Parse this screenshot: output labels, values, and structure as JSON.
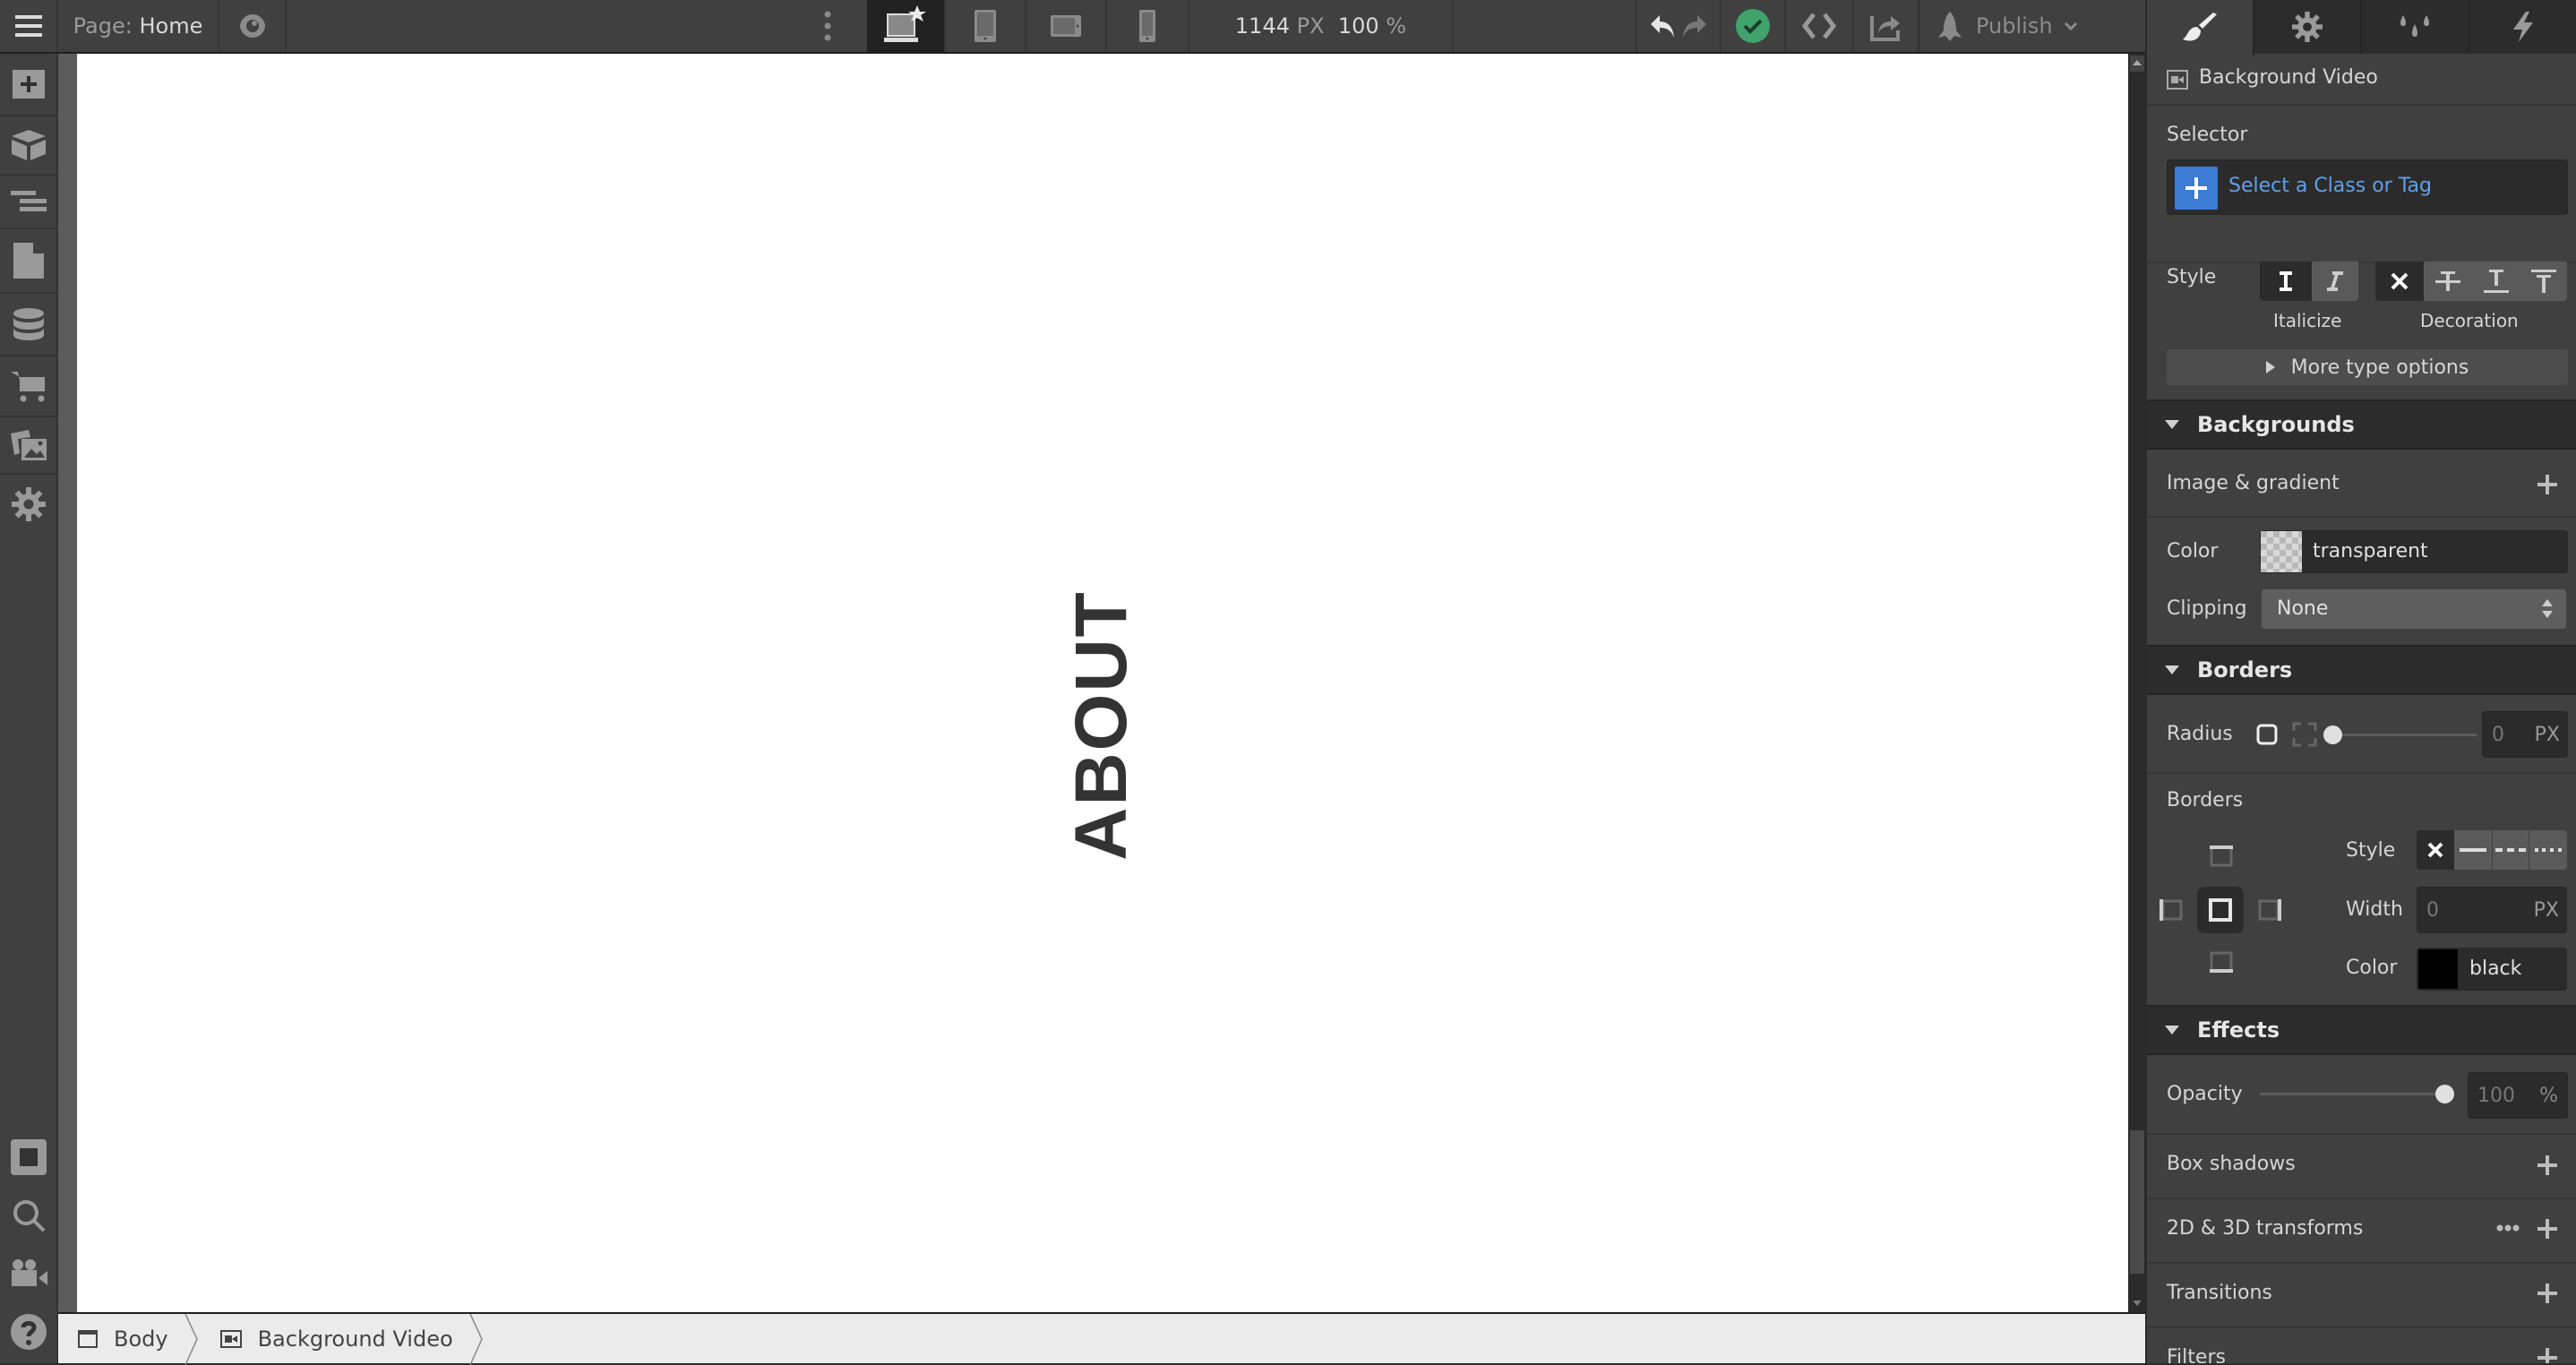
{
  "topbar": {
    "page_label": "Page:",
    "page_name": "Home",
    "canvas_width": "1144",
    "canvas_width_unit": "PX",
    "zoom": "100",
    "zoom_unit": "%",
    "publish_label": "Publish",
    "status_color": "#3fa36b",
    "breakpoints": [
      "desktop-base",
      "tablet",
      "mobile-landscape",
      "mobile-portrait"
    ],
    "active_breakpoint": "desktop-base"
  },
  "left_sidebar": {
    "items": [
      "add-panel",
      "symbols",
      "navigator",
      "pages",
      "cms",
      "ecommerce",
      "assets",
      "settings"
    ],
    "bottom_items": [
      "toggle-edges",
      "search",
      "video-tutorials",
      "help"
    ]
  },
  "canvas": {
    "heading_text": "ABOUT"
  },
  "breadcrumb": {
    "items": [
      {
        "label": "Body",
        "icon": "body-icon"
      },
      {
        "label": "Background Video",
        "icon": "video-icon"
      }
    ]
  },
  "panel": {
    "tabs": [
      "style",
      "settings",
      "style-manager",
      "interactions"
    ],
    "active_tab": "style",
    "element_name": "Background Video",
    "selector_label": "Selector",
    "selector_placeholder": "Select a Class or Tag",
    "accent_color": "#3b7bd4",
    "typography": {
      "style_label": "Style",
      "italicize_label": "Italicize",
      "decoration_label": "Decoration",
      "more_label": "More type options"
    },
    "backgrounds": {
      "title": "Backgrounds",
      "image_gradient_label": "Image & gradient",
      "color_label": "Color",
      "color_value": "transparent",
      "clipping_label": "Clipping",
      "clipping_value": "None"
    },
    "borders": {
      "title": "Borders",
      "radius_label": "Radius",
      "radius_value": "0",
      "radius_unit": "PX",
      "borders_label": "Borders",
      "style_label": "Style",
      "width_label": "Width",
      "width_value": "0",
      "width_unit": "PX",
      "color_label": "Color",
      "color_value": "black",
      "color_swatch": "#000000"
    },
    "effects": {
      "title": "Effects",
      "opacity_label": "Opacity",
      "opacity_value": "100",
      "opacity_unit": "%",
      "opacity_fraction": 1.0,
      "box_shadows_label": "Box shadows",
      "transforms_label": "2D & 3D transforms",
      "transitions_label": "Transitions",
      "filters_label": "Filters"
    }
  }
}
